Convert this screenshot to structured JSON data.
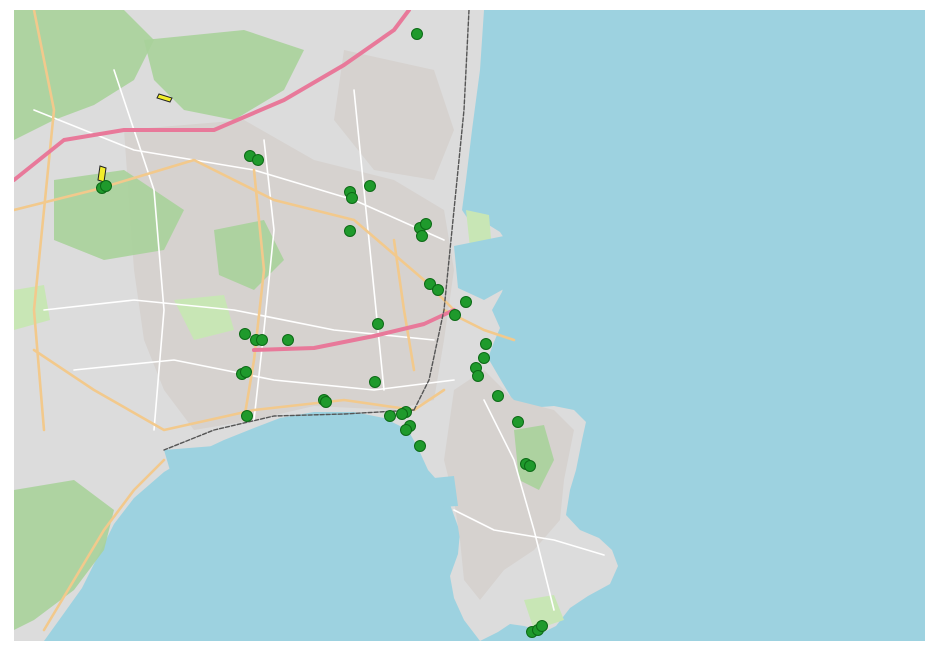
{
  "map": {
    "colors": {
      "sea": "#9dd2e0",
      "land": "#dcdcdc",
      "urban": "#d6d2cf",
      "forest": "#a8d29a",
      "park": "#c8e6b5",
      "motorway": "#e8799a",
      "primary_road": "#f2c98c",
      "minor_road": "#ffffff",
      "railway": "#555555",
      "marker_fill": "#1f9a2c",
      "marker_stroke": "#0c6a16",
      "highlight_fill": "#f2ee2a"
    },
    "markers": [
      {
        "id": "m01"
      },
      {
        "id": "m02"
      },
      {
        "id": "m03"
      },
      {
        "id": "m04"
      },
      {
        "id": "m05"
      },
      {
        "id": "m06"
      },
      {
        "id": "m07"
      },
      {
        "id": "m08"
      },
      {
        "id": "m09"
      },
      {
        "id": "m10"
      },
      {
        "id": "m11"
      },
      {
        "id": "m12"
      },
      {
        "id": "m13"
      },
      {
        "id": "m14"
      },
      {
        "id": "m15"
      },
      {
        "id": "m16"
      },
      {
        "id": "m17"
      },
      {
        "id": "m18"
      },
      {
        "id": "m19"
      },
      {
        "id": "m20"
      },
      {
        "id": "m21"
      },
      {
        "id": "m22"
      },
      {
        "id": "m23"
      },
      {
        "id": "m24"
      },
      {
        "id": "m25"
      },
      {
        "id": "m26"
      },
      {
        "id": "m27"
      },
      {
        "id": "m28"
      },
      {
        "id": "m29"
      },
      {
        "id": "m30"
      },
      {
        "id": "m31"
      },
      {
        "id": "m32"
      },
      {
        "id": "m33"
      },
      {
        "id": "m34"
      },
      {
        "id": "m35"
      },
      {
        "id": "m36"
      },
      {
        "id": "m37"
      },
      {
        "id": "m38"
      },
      {
        "id": "m39"
      },
      {
        "id": "m40"
      },
      {
        "id": "m41"
      },
      {
        "id": "m42"
      },
      {
        "id": "m43"
      },
      {
        "id": "m44"
      }
    ],
    "highlights": [
      {
        "id": "h1"
      },
      {
        "id": "h2"
      }
    ]
  }
}
